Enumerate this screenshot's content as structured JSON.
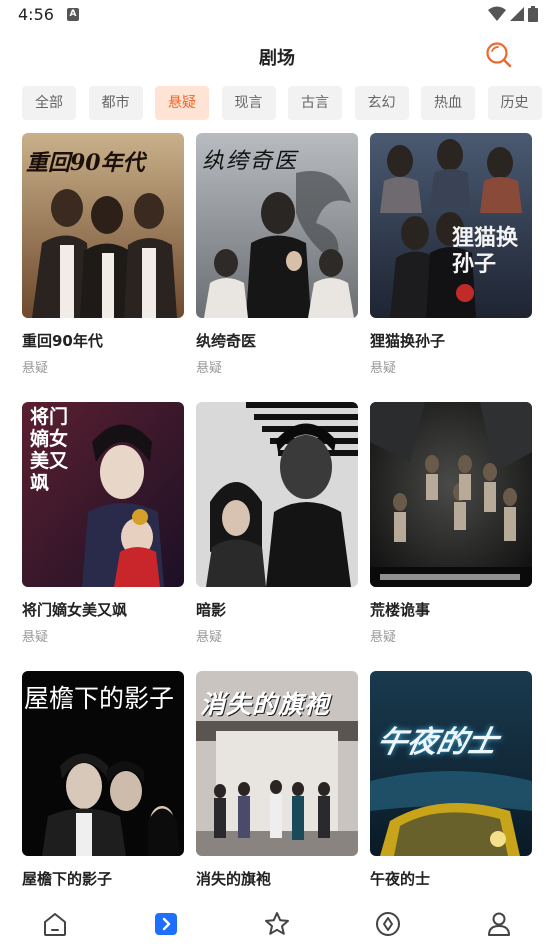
{
  "status": {
    "time": "4:56",
    "notification_letter": "A"
  },
  "header": {
    "title": "剧场"
  },
  "tabs": [
    {
      "label": "全部",
      "active": false
    },
    {
      "label": "都市",
      "active": false
    },
    {
      "label": "悬疑",
      "active": true
    },
    {
      "label": "现言",
      "active": false
    },
    {
      "label": "古言",
      "active": false
    },
    {
      "label": "玄幻",
      "active": false
    },
    {
      "label": "热血",
      "active": false
    },
    {
      "label": "历史",
      "active": false
    }
  ],
  "dramas": [
    {
      "title": "重回90年代",
      "genre": "悬疑",
      "poster_text": "重回90年代"
    },
    {
      "title": "纨绔奇医",
      "genre": "悬疑",
      "poster_text": "纨绔奇医"
    },
    {
      "title": "狸猫换孙子",
      "genre": "悬疑",
      "poster_text": "狸猫换孙子"
    },
    {
      "title": "将门嫡女美又飒",
      "genre": "悬疑",
      "poster_text": "将门嫡女美又飒"
    },
    {
      "title": "暗影",
      "genre": "悬疑",
      "poster_text": ""
    },
    {
      "title": "荒楼诡事",
      "genre": "悬疑",
      "poster_text": ""
    },
    {
      "title": "屋檐下的影子",
      "genre": "",
      "poster_text": "屋檐下的影子"
    },
    {
      "title": "消失的旗袍",
      "genre": "",
      "poster_text": "消失的旗袍"
    },
    {
      "title": "午夜的士",
      "genre": "",
      "poster_text": "午夜的士"
    }
  ],
  "bottom_nav": [
    {
      "name": "home",
      "icon": "home-icon",
      "active": false
    },
    {
      "name": "theater",
      "icon": "play-icon",
      "active": true
    },
    {
      "name": "favorites",
      "icon": "star-icon",
      "active": false
    },
    {
      "name": "discover",
      "icon": "compass-icon",
      "active": false
    },
    {
      "name": "profile",
      "icon": "person-icon",
      "active": false
    }
  ],
  "colors": {
    "accent": "#f0662b",
    "active_tab_bg": "#ffe3d4",
    "tab_bg": "#f2f2f2",
    "nav_active": "#1f6fff",
    "nav_icon": "#444444"
  }
}
